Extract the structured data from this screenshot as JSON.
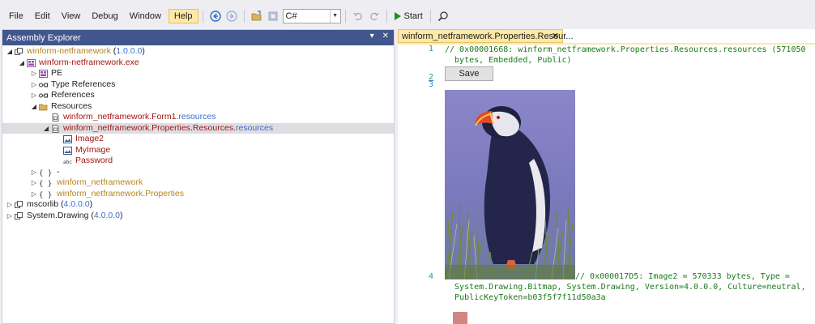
{
  "menu": [
    "File",
    "Edit",
    "View",
    "Debug",
    "Window",
    "Help"
  ],
  "toolbar": {
    "language": "C#",
    "start_label": "Start"
  },
  "left_panel": {
    "title": "Assembly Explorer",
    "tree": [
      {
        "depth": 0,
        "exp": "◢",
        "icon": "assembly-icon",
        "parts": [
          {
            "t": "winform-netframework",
            "c": "gold"
          },
          {
            "t": " (",
            "c": "black"
          },
          {
            "t": "1.0.0.0",
            "c": "blue"
          },
          {
            "t": ")",
            "c": "black"
          }
        ]
      },
      {
        "depth": 1,
        "exp": "◢",
        "icon": "module-icon",
        "parts": [
          {
            "t": "winform-netframework.exe",
            "c": "brown"
          }
        ]
      },
      {
        "depth": 2,
        "exp": "▷",
        "icon": "pe-icon",
        "parts": [
          {
            "t": "PE",
            "c": "black"
          }
        ]
      },
      {
        "depth": 2,
        "exp": "▷",
        "icon": "type-references-icon",
        "parts": [
          {
            "t": "Type References",
            "c": "black"
          }
        ]
      },
      {
        "depth": 2,
        "exp": "▷",
        "icon": "references-icon",
        "parts": [
          {
            "t": "References",
            "c": "black"
          }
        ]
      },
      {
        "depth": 2,
        "exp": "◢",
        "icon": "folder-open-icon",
        "parts": [
          {
            "t": "Resources",
            "c": "black"
          }
        ]
      },
      {
        "depth": 3,
        "exp": "",
        "icon": "resource-file-icon",
        "parts": [
          {
            "t": "winform_netframework.Form1.",
            "c": "brown"
          },
          {
            "t": "resources",
            "c": "blue"
          }
        ]
      },
      {
        "depth": 3,
        "exp": "◢",
        "icon": "resource-file-icon",
        "sel": true,
        "parts": [
          {
            "t": "winform_netframework.Properties.Resources.",
            "c": "brown"
          },
          {
            "t": "resources",
            "c": "blue"
          }
        ]
      },
      {
        "depth": 4,
        "exp": "",
        "icon": "image-icon",
        "parts": [
          {
            "t": "Image2",
            "c": "brown"
          }
        ]
      },
      {
        "depth": 4,
        "exp": "",
        "icon": "image-icon",
        "parts": [
          {
            "t": "MyImage",
            "c": "brown"
          }
        ]
      },
      {
        "depth": 4,
        "exp": "",
        "icon": "string-icon",
        "parts": [
          {
            "t": "Password",
            "c": "brown"
          }
        ]
      },
      {
        "depth": 2,
        "exp": "▷",
        "icon": "namespace-icon",
        "parts": [
          {
            "t": "-",
            "c": "black"
          }
        ]
      },
      {
        "depth": 2,
        "exp": "▷",
        "icon": "namespace-icon",
        "parts": [
          {
            "t": "winform_netframework",
            "c": "gold"
          }
        ]
      },
      {
        "depth": 2,
        "exp": "▷",
        "icon": "namespace-icon",
        "parts": [
          {
            "t": "winform_netframework.Properties",
            "c": "gold"
          }
        ]
      },
      {
        "depth": 0,
        "exp": "▷",
        "icon": "assembly-icon",
        "parts": [
          {
            "t": "mscorlib",
            "c": "black"
          },
          {
            "t": " (",
            "c": "black"
          },
          {
            "t": "4.0.0.0",
            "c": "blue"
          },
          {
            "t": ")",
            "c": "black"
          }
        ]
      },
      {
        "depth": 0,
        "exp": "▷",
        "icon": "assembly-icon",
        "parts": [
          {
            "t": "System.Drawing",
            "c": "black"
          },
          {
            "t": " (",
            "c": "black"
          },
          {
            "t": "4.0.0.0",
            "c": "blue"
          },
          {
            "t": ")",
            "c": "black"
          }
        ]
      }
    ]
  },
  "editor": {
    "tab_title": "winform_netframework.Properties.Resour...",
    "line_numbers": [
      "1",
      "2",
      "3",
      "4"
    ],
    "line1": "// 0x00001668: winform_netframework.Properties.Resources.resources (571050",
    "line1b": "  bytes, Embedded, Public)",
    "save_label": "Save",
    "line4": "// 0x000017D5: Image2 = 570333 bytes, Type =",
    "line4b": "  System.Drawing.Bitmap, System.Drawing, Version=4.0.0.0, Culture=neutral,",
    "line4c": "  PublicKeyToken=b03f5f7f11d50a3a"
  },
  "colors": {
    "accent": "#40568d",
    "tab": "#fde8a6",
    "comment": "#1b7a1b",
    "line_number": "#2b91af"
  }
}
